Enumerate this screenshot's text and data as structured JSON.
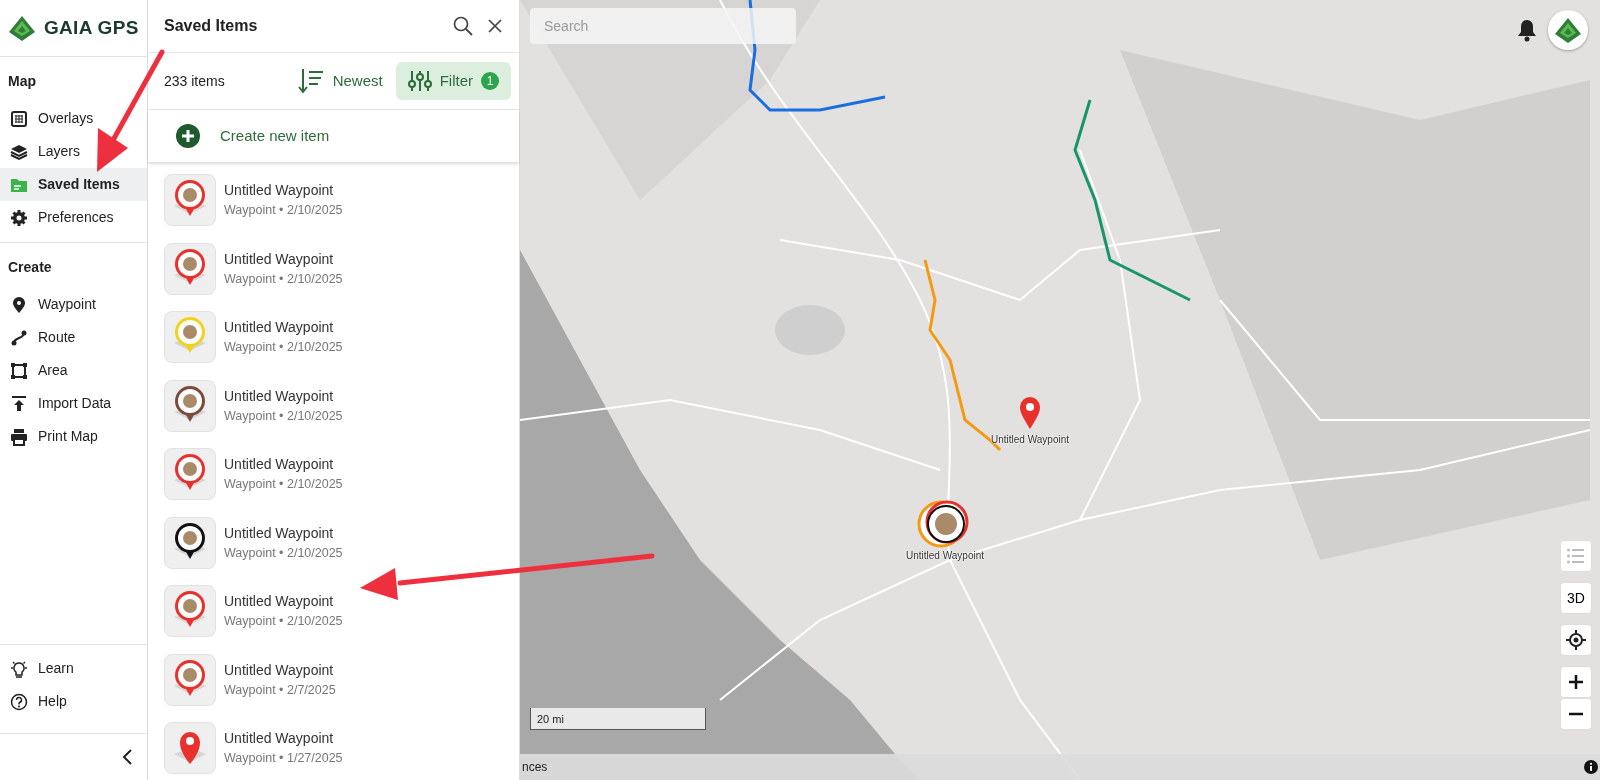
{
  "brand": {
    "name": "GAIA GPS"
  },
  "sidebar": {
    "sections": [
      {
        "title": "Map",
        "items": [
          {
            "label": "Overlays",
            "selected": false
          },
          {
            "label": "Layers",
            "selected": false
          },
          {
            "label": "Saved Items",
            "selected": true
          },
          {
            "label": "Preferences",
            "selected": false
          }
        ]
      },
      {
        "title": "Create",
        "items": [
          {
            "label": "Waypoint",
            "selected": false
          },
          {
            "label": "Route",
            "selected": false
          },
          {
            "label": "Area",
            "selected": false
          },
          {
            "label": "Import Data",
            "selected": false
          },
          {
            "label": "Print Map",
            "selected": false
          }
        ]
      }
    ],
    "footer_items": [
      {
        "label": "Learn"
      },
      {
        "label": "Help"
      }
    ]
  },
  "panel": {
    "title": "Saved Items",
    "count": "233 items",
    "sort": "Newest",
    "filter": {
      "label": "Filter",
      "badge": "1"
    },
    "create": "Create new item",
    "items": [
      {
        "title": "Untitled Waypoint",
        "meta": "Waypoint • 2/10/2025",
        "kind": "badge",
        "color": "#e8302c"
      },
      {
        "title": "Untitled Waypoint",
        "meta": "Waypoint • 2/10/2025",
        "kind": "badge",
        "color": "#e8302c"
      },
      {
        "title": "Untitled Waypoint",
        "meta": "Waypoint • 2/10/2025",
        "kind": "badge",
        "color": "#f2d21b"
      },
      {
        "title": "Untitled Waypoint",
        "meta": "Waypoint • 2/10/2025",
        "kind": "badge",
        "color": "#7a4b3a"
      },
      {
        "title": "Untitled Waypoint",
        "meta": "Waypoint • 2/10/2025",
        "kind": "badge",
        "color": "#e8302c"
      },
      {
        "title": "Untitled Waypoint",
        "meta": "Waypoint • 2/10/2025",
        "kind": "badge",
        "color": "#111111"
      },
      {
        "title": "Untitled Waypoint",
        "meta": "Waypoint • 2/10/2025",
        "kind": "badge",
        "color": "#e8302c"
      },
      {
        "title": "Untitled Waypoint",
        "meta": "Waypoint • 2/7/2025",
        "kind": "badge",
        "color": "#e8302c"
      },
      {
        "title": "Untitled Waypoint",
        "meta": "Waypoint • 1/27/2025",
        "kind": "pin",
        "color": "#e8302c"
      }
    ]
  },
  "map": {
    "search": {
      "placeholder": "Search"
    },
    "markers": [
      {
        "label": "Untitled Waypoint",
        "kind": "pin"
      },
      {
        "label": "Untitled Waypoint",
        "kind": "cluster"
      }
    ],
    "scale": "20 mi",
    "view_button": "3D",
    "attribution": "nces"
  }
}
